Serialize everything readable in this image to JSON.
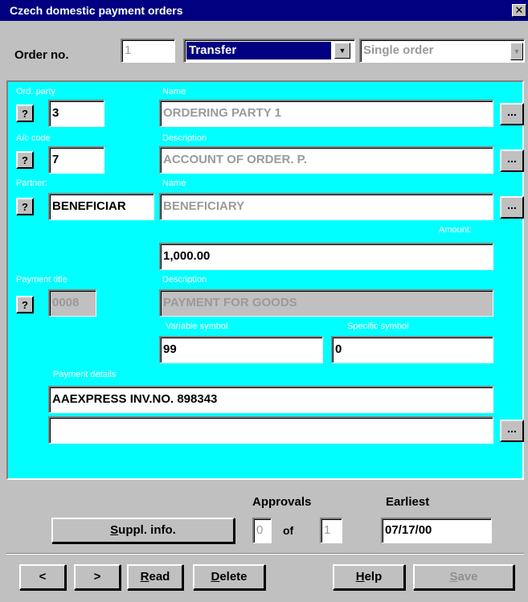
{
  "window": {
    "title": "Czech domestic payment orders"
  },
  "header": {
    "order_no_label": "Order no.",
    "order_no_value": "1",
    "order_type": "Transfer",
    "order_kind": "Single order"
  },
  "form": {
    "ord_party": {
      "label": "Ord. party",
      "code": "3",
      "name_label": "Name",
      "name": "ORDERING PARTY 1"
    },
    "ac_code": {
      "label": "A/c code",
      "code": "7",
      "desc_label": "Description",
      "desc": "ACCOUNT OF ORDER. P."
    },
    "partner": {
      "label": "Partner:",
      "code": "BENEFICIAR",
      "name_label": "Name",
      "name": "BENEFICIARY"
    },
    "amount": {
      "label": "Amount:",
      "value": "1,000.00"
    },
    "payment_title": {
      "label": "Payment title",
      "code": "0008",
      "desc_label": "Description",
      "desc": "PAYMENT FOR GOODS"
    },
    "variable_symbol": {
      "label": "Variable symbol",
      "value": "99"
    },
    "specific_symbol": {
      "label": "Specific symbol",
      "value": "0"
    },
    "payment_details": {
      "label": "Payment details",
      "line1": "AAEXPRESS INV.NO. 898343",
      "line2": ""
    },
    "q_glyph": "?",
    "dots_glyph": "..."
  },
  "bottom": {
    "approvals_label": "Approvals",
    "approvals_value": "0",
    "of_label": "of",
    "approvals_total": "1",
    "earliest_label": "Earliest",
    "earliest_value": "07/17/00",
    "suppl_prefix": "",
    "suppl_accel": "S",
    "suppl_rest": "uppl. info."
  },
  "toolbar": {
    "prev": "<",
    "next": ">",
    "read_accel": "R",
    "read_rest": "ead",
    "delete_accel": "D",
    "delete_rest": "elete",
    "help_accel": "H",
    "help_rest": "elp",
    "save_accel": "S",
    "save_rest": "ave"
  },
  "icons": {
    "close": "close-icon",
    "dropdown": "chevron-down-icon"
  },
  "colors": {
    "titlebar": "#000080",
    "panel": "#00ffff",
    "face": "#c0c0c0"
  }
}
